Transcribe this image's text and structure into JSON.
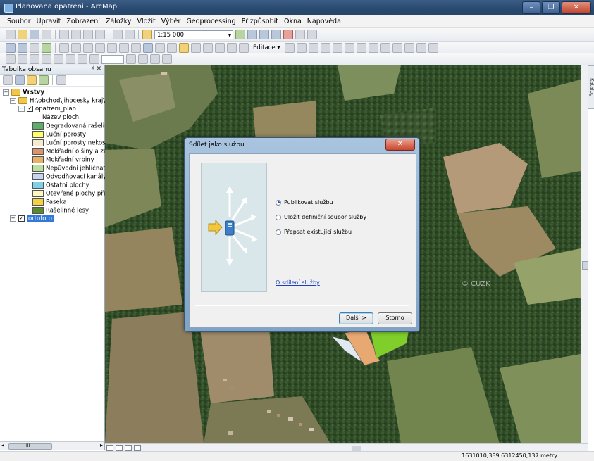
{
  "window": {
    "title": "Planovana opatreni - ArcMap",
    "minimize": "–",
    "maximize": "❐",
    "close": "✕"
  },
  "menu": [
    "Soubor",
    "Upravit",
    "Zobrazení",
    "Záložky",
    "Vložit",
    "Výběr",
    "Geoprocessing",
    "Přizpůsobit",
    "Okna",
    "Nápověda"
  ],
  "toolbar": {
    "scale_value": "1:15 000",
    "editor_label": "Editace ▾"
  },
  "toc": {
    "header": "Tabulka obsahu",
    "pin": "♯ ✕",
    "root_label": "Vrstvy",
    "folder_label": "H:\\obchod\\jihocesky kraj\\",
    "layer_label": "opatreni_plan",
    "field_label": "Název ploch",
    "legend": [
      {
        "label": "Degradovaná rašelin",
        "color": "#5cae6a"
      },
      {
        "label": "Luční porosty",
        "color": "#ffff66"
      },
      {
        "label": "Luční porosty nekos",
        "color": "#f5ecd0"
      },
      {
        "label": "Mokřadní olšiny a za",
        "color": "#d9946b"
      },
      {
        "label": "Mokřadní vrbiny",
        "color": "#e8b169"
      },
      {
        "label": "Nepůvodní jehličnat",
        "color": "#b9e0a0"
      },
      {
        "label": "Odvodňovací kanály",
        "color": "#c9d4f0"
      },
      {
        "label": "Ostatní plochy",
        "color": "#7fd0e6"
      },
      {
        "label": "Otevřené plochy pře",
        "color": "#fff8c0"
      },
      {
        "label": "Paseka",
        "color": "#f5d242"
      },
      {
        "label": "Rašelinné lesy",
        "color": "#5a8a2c"
      }
    ],
    "ortho_label": "ortofoto",
    "scroll_mark": "III"
  },
  "dialog": {
    "title": "Sdílet jako službu",
    "close": "✕",
    "options": [
      {
        "label": "Publikovat službu",
        "selected": true
      },
      {
        "label": "Uložit definiční soubor služby",
        "selected": false
      },
      {
        "label": "Přepsat existující službu",
        "selected": false
      }
    ],
    "link": "O sdílení služby",
    "next_button": "Další >",
    "cancel_button": "Storno"
  },
  "map": {
    "watermark": "© CUZK"
  },
  "catalog_tab": "Katalog",
  "status": {
    "coordinates": "1631010,389  6312450,137 metry"
  }
}
